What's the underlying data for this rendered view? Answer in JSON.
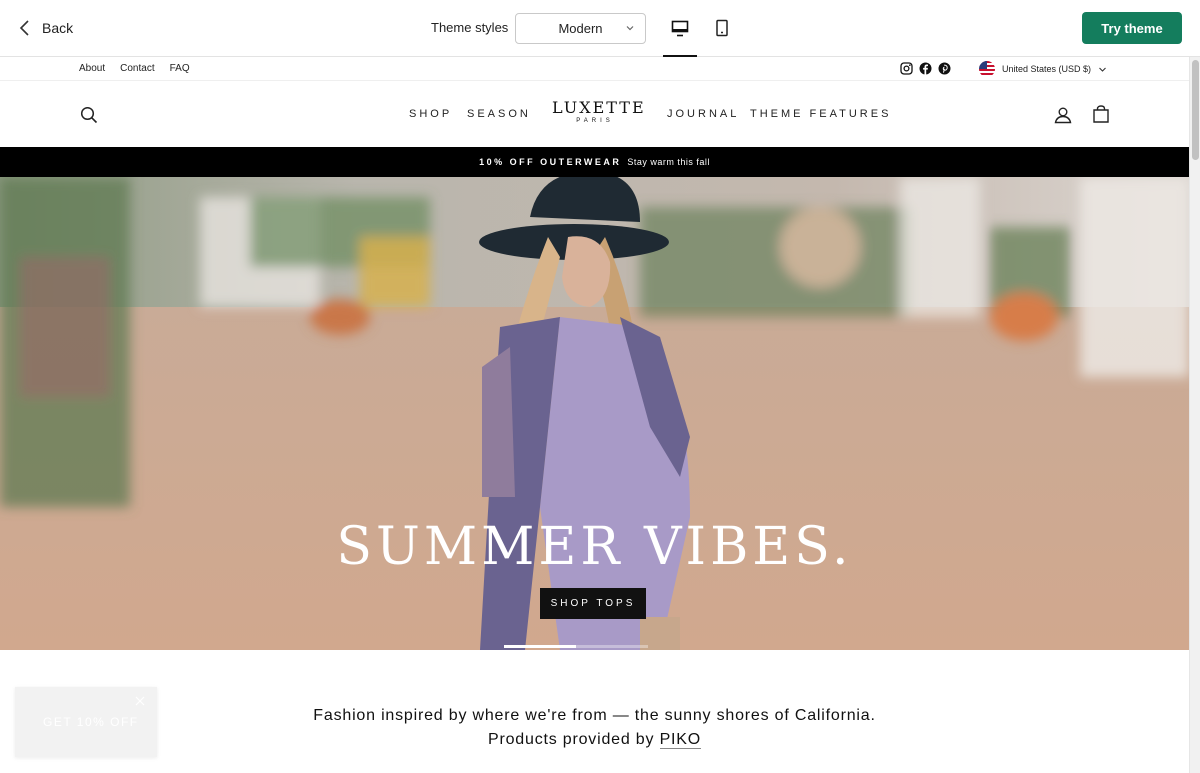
{
  "editor": {
    "back_label": "Back",
    "theme_styles_label": "Theme styles",
    "theme_select_value": "Modern",
    "try_theme_label": "Try theme",
    "accent_color": "#147d5d",
    "device_icons": [
      "desktop-icon",
      "mobile-icon"
    ]
  },
  "store": {
    "util_links": [
      "About",
      "Contact",
      "FAQ"
    ],
    "social_icons": [
      "instagram-icon",
      "facebook-icon",
      "pinterest-icon"
    ],
    "currency": "United States (USD $)",
    "nav_left": [
      "SHOP",
      "SEASON"
    ],
    "nav_right": [
      "JOURNAL",
      "THEME FEATURES"
    ],
    "logo_main": "LUXETTE",
    "logo_sub": "PARIS",
    "announcement_strong": "10% OFF OUTERWEAR",
    "announcement_light": "Stay warm this fall",
    "hero_heading": "SUMMER VIBES.",
    "hero_button": "SHOP TOPS",
    "intro_line1": "Fashion inspired by where we're from — the sunny shores of California.",
    "intro_line2_prefix": "Products provided by",
    "intro_link": "PIKO",
    "popup_text": "GET 10% OFF"
  }
}
